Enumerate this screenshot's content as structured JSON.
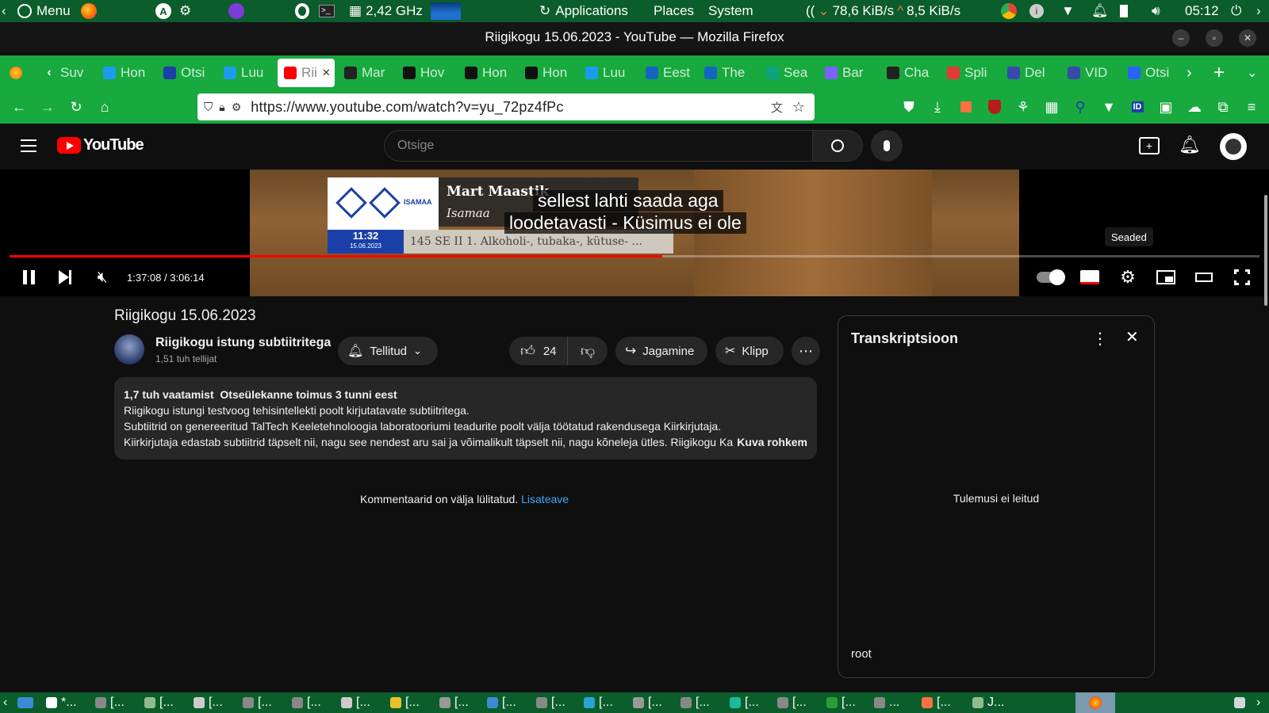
{
  "system_bar": {
    "menu_label": "Menu",
    "cpu_freq": "2,42 GHz",
    "applications": "Applications",
    "places": "Places",
    "system": "System",
    "net_down": "78,6 KiB/s",
    "net_up": "8,5 KiB/s",
    "clock": "05:12"
  },
  "window": {
    "title": "Riigikogu 15.06.2023 - YouTube — Mozilla Firefox"
  },
  "tabs": [
    {
      "label": "Suv",
      "icon": "back-icon",
      "color": "#ffffff"
    },
    {
      "label": "Hon",
      "icon": "twitter-icon",
      "color": "#1d9bf0"
    },
    {
      "label": "Otsi",
      "icon": "grid-icon",
      "color": "#1a3fa8"
    },
    {
      "label": "Luu",
      "icon": "twitter-icon",
      "color": "#1d9bf0"
    },
    {
      "label": "Rii",
      "icon": "youtube-icon",
      "color": "#ff0000",
      "active": true
    },
    {
      "label": "Mar",
      "icon": "wikipedia-icon",
      "color": "#222222"
    },
    {
      "label": "Hov",
      "icon": "r-icon",
      "color": "#111111"
    },
    {
      "label": "Hon",
      "icon": "r-icon",
      "color": "#111111"
    },
    {
      "label": "Hon",
      "icon": "r-icon",
      "color": "#111111"
    },
    {
      "label": "Luu",
      "icon": "twitter-icon",
      "color": "#1d9bf0"
    },
    {
      "label": "Eest",
      "icon": "rt-icon",
      "color": "#1565c0"
    },
    {
      "label": "The",
      "icon": "rt-icon",
      "color": "#1565c0"
    },
    {
      "label": "Sea",
      "icon": "openai-icon",
      "color": "#10a37f"
    },
    {
      "label": "Bar",
      "icon": "bard-icon",
      "color": "#7b61ff"
    },
    {
      "label": "Cha",
      "icon": "wikipedia-icon",
      "color": "#222222"
    },
    {
      "label": "Spli",
      "icon": "split-icon",
      "color": "#e53935"
    },
    {
      "label": "Del",
      "icon": "deepl-icon",
      "color": "#3949ab"
    },
    {
      "label": "VID",
      "icon": "deepl-icon",
      "color": "#3949ab"
    },
    {
      "label": "Otsi",
      "icon": "glasses-icon",
      "color": "#2962ff"
    }
  ],
  "address_bar": {
    "url": "https://www.youtube.com/watch?v=yu_72pz4fPc"
  },
  "youtube": {
    "logo_text": "YouTube",
    "search_placeholder": "Otsige"
  },
  "player": {
    "subtitle_line1": "sellest lahti saada aga",
    "subtitle_line2": "loodetavasti -  Küsimus ei ole",
    "overlay_name": "Mart Maastik",
    "overlay_party": "Isamaa",
    "overlay_party_logo": "ISAMAA",
    "overlay_time": "11:32",
    "overlay_date": "15.06.2023",
    "overlay_ticker": "145 SE II 1. Alkoholi-, tubaka-, kütuse- ...",
    "time_current": "1:37:08",
    "time_separator": " / ",
    "time_total": "3:06:14",
    "progress_fraction": 0.522,
    "tooltip": "Seaded"
  },
  "video": {
    "title": "Riigikogu 15.06.2023",
    "channel_name": "Riigikogu istung subtiitritega",
    "subscribers": "1,51 tuh tellijat",
    "subscribe_label": "Tellitud",
    "likes": "24",
    "share_label": "Jagamine",
    "clip_label": "Klipp"
  },
  "description": {
    "views": "1,7 tuh vaatamist",
    "stream_info": "Otseülekanne toimus 3 tunni eest",
    "line1": "Riigikogu istungi testvoog tehisintellekti poolt kirjutatavate subtiitritega.",
    "line2": "Subtiitrid on genereeritud TalTech Keeletehnoloogia laboratooriumi teadurite poolt välja töötatud rakendusega Kiirkirjutaja.",
    "line3": "Kiirkirjutaja edastab subtiitrid täpselt nii, nagu see nendest aru sai ja võimalikult täpselt nii, nagu kõneleja ütles. Riigikogu Kan",
    "more": "Kuva rohkem"
  },
  "comments": {
    "disabled_text": "Kommentaarid on välja lülitatud.",
    "learn_more": "Lisateave"
  },
  "transcript": {
    "title": "Transkriptsioon",
    "no_results": "Tulemusi ei leitud",
    "footer": "root"
  },
  "taskbar": {
    "items": [
      "*...",
      "[...",
      "[...",
      "[...",
      "[...",
      "[...",
      "[...",
      "[...",
      "[...",
      "[...",
      "[...",
      "[...",
      "[...",
      "[...",
      "[...",
      "[...",
      "[...",
      "...",
      "[...",
      "J..."
    ]
  },
  "colors": {
    "system_green": "#0b5d2b",
    "browser_green": "#18a93f",
    "youtube_red": "#ff0000",
    "link_blue": "#3ea6ff"
  }
}
